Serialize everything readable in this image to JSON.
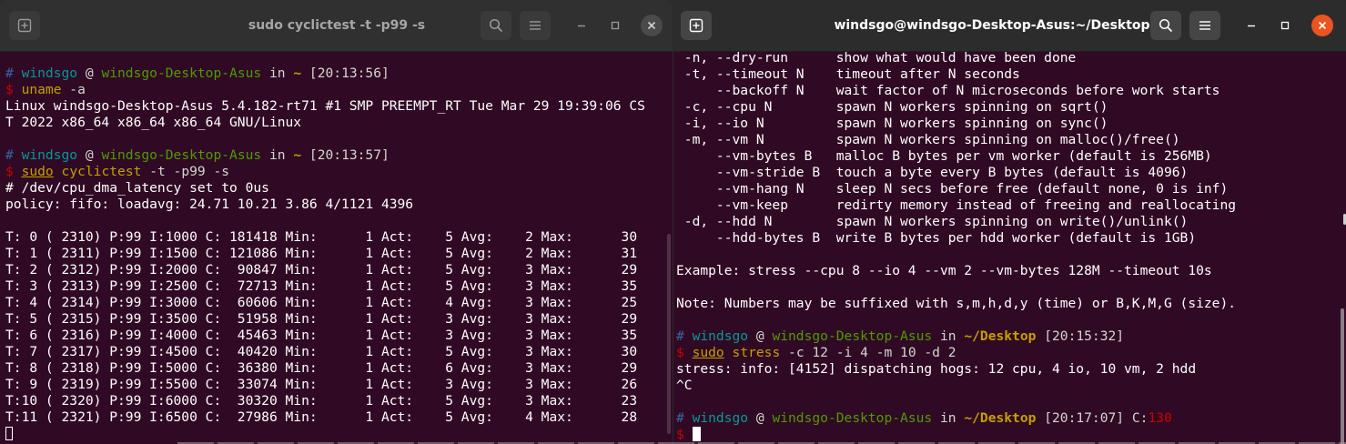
{
  "left_window": {
    "title": "sudo cyclictest -t -p99 -s",
    "lines": [
      [
        {
          "t": "# ",
          "c": "hash"
        },
        {
          "t": "windsgo",
          "c": "user"
        },
        {
          "t": " @ ",
          "c": "at"
        },
        {
          "t": "windsgo-Desktop-Asus",
          "c": "host"
        },
        {
          "t": " in ",
          "c": "in"
        },
        {
          "t": "~",
          "c": "path"
        },
        {
          "t": " [20:13:56]",
          "c": "time"
        }
      ],
      [
        {
          "t": "$ ",
          "c": "dollar"
        },
        {
          "t": "uname",
          "c": "cmd"
        },
        {
          "t": " -a",
          "c": "args"
        }
      ],
      [
        {
          "t": "Linux windsgo-Desktop-Asus 5.4.182-rt71 #1 SMP PREEMPT_RT Tue Mar 29 19:39:06 CS"
        }
      ],
      [
        {
          "t": "T 2022 x86_64 x86_64 x86_64 GNU/Linux"
        }
      ],
      [],
      [
        {
          "t": "# ",
          "c": "hash"
        },
        {
          "t": "windsgo",
          "c": "user"
        },
        {
          "t": " @ ",
          "c": "at"
        },
        {
          "t": "windsgo-Desktop-Asus",
          "c": "host"
        },
        {
          "t": " in ",
          "c": "in"
        },
        {
          "t": "~",
          "c": "path"
        },
        {
          "t": " [20:13:57]",
          "c": "time"
        }
      ],
      [
        {
          "t": "$ ",
          "c": "dollar"
        },
        {
          "t": "sudo",
          "c": "cmdu"
        },
        {
          "t": " ",
          "c": "args"
        },
        {
          "t": "cyclictest",
          "c": "cmd"
        },
        {
          "t": " -t -p99 -s",
          "c": "args"
        }
      ],
      [
        {
          "t": "# /dev/cpu_dma_latency set to 0us"
        }
      ],
      [
        {
          "t": "policy: fifo: loadavg: 24.71 10.21 3.86 4/1121 4396"
        }
      ],
      [],
      [
        {
          "t": "T: 0 ( 2310) P:99 I:1000 C: 181418 Min:      1 Act:    5 Avg:    2 Max:      30"
        }
      ],
      [
        {
          "t": "T: 1 ( 2311) P:99 I:1500 C: 121086 Min:      1 Act:    5 Avg:    2 Max:      31"
        }
      ],
      [
        {
          "t": "T: 2 ( 2312) P:99 I:2000 C:  90847 Min:      1 Act:    5 Avg:    3 Max:      29"
        }
      ],
      [
        {
          "t": "T: 3 ( 2313) P:99 I:2500 C:  72713 Min:      1 Act:    5 Avg:    3 Max:      35"
        }
      ],
      [
        {
          "t": "T: 4 ( 2314) P:99 I:3000 C:  60606 Min:      1 Act:    4 Avg:    3 Max:      25"
        }
      ],
      [
        {
          "t": "T: 5 ( 2315) P:99 I:3500 C:  51958 Min:      1 Act:    3 Avg:    3 Max:      29"
        }
      ],
      [
        {
          "t": "T: 6 ( 2316) P:99 I:4000 C:  45463 Min:      1 Act:    3 Avg:    3 Max:      35"
        }
      ],
      [
        {
          "t": "T: 7 ( 2317) P:99 I:4500 C:  40420 Min:      1 Act:    5 Avg:    3 Max:      30"
        }
      ],
      [
        {
          "t": "T: 8 ( 2318) P:99 I:5000 C:  36380 Min:      1 Act:    6 Avg:    3 Max:      29"
        }
      ],
      [
        {
          "t": "T: 9 ( 2319) P:99 I:5500 C:  33074 Min:      1 Act:    3 Avg:    3 Max:      26"
        }
      ],
      [
        {
          "t": "T:10 ( 2320) P:99 I:6000 C:  30320 Min:      1 Act:    5 Avg:    3 Max:      23"
        }
      ],
      [
        {
          "t": "T:11 ( 2321) P:99 I:6500 C:  27986 Min:      1 Act:    5 Avg:    4 Max:      28"
        }
      ],
      [
        {
          "cursor": "hollow"
        }
      ]
    ]
  },
  "right_window": {
    "title": "windsgo@windsgo-Desktop-Asus:~/Desktop",
    "lines": [
      [
        {
          "t": " -n, --dry-run      show what would have been done"
        }
      ],
      [
        {
          "t": " -t, --timeout N    timeout after N seconds"
        }
      ],
      [
        {
          "t": "     --backoff N    wait factor of N microseconds before work starts"
        }
      ],
      [
        {
          "t": " -c, --cpu N        spawn N workers spinning on sqrt()"
        }
      ],
      [
        {
          "t": " -i, --io N         spawn N workers spinning on sync()"
        }
      ],
      [
        {
          "t": " -m, --vm N         spawn N workers spinning on malloc()/free()"
        }
      ],
      [
        {
          "t": "     --vm-bytes B   malloc B bytes per vm worker (default is 256MB)"
        }
      ],
      [
        {
          "t": "     --vm-stride B  touch a byte every B bytes (default is 4096)"
        }
      ],
      [
        {
          "t": "     --vm-hang N    sleep N secs before free (default none, 0 is inf)"
        }
      ],
      [
        {
          "t": "     --vm-keep      redirty memory instead of freeing and reallocating"
        }
      ],
      [
        {
          "t": " -d, --hdd N        spawn N workers spinning on write()/unlink()"
        }
      ],
      [
        {
          "t": "     --hdd-bytes B  write B bytes per hdd worker (default is 1GB)"
        }
      ],
      [],
      [
        {
          "t": "Example: stress --cpu 8 --io 4 --vm 2 --vm-bytes 128M --timeout 10s"
        }
      ],
      [],
      [
        {
          "t": "Note: Numbers may be suffixed with s,m,h,d,y (time) or B,K,M,G (size)."
        }
      ],
      [],
      [
        {
          "t": "# ",
          "c": "hash"
        },
        {
          "t": "windsgo",
          "c": "user"
        },
        {
          "t": " @ ",
          "c": "at"
        },
        {
          "t": "windsgo-Desktop-Asus",
          "c": "host"
        },
        {
          "t": " in ",
          "c": "in"
        },
        {
          "t": "~/Desktop",
          "c": "path"
        },
        {
          "t": " [20:15:32]",
          "c": "time"
        }
      ],
      [
        {
          "t": "$ ",
          "c": "dollar"
        },
        {
          "t": "sudo",
          "c": "cmdu"
        },
        {
          "t": " ",
          "c": "args"
        },
        {
          "t": "stress",
          "c": "cmd"
        },
        {
          "t": " -c 12 -i 4 -m 10 -d 2",
          "c": "args"
        }
      ],
      [
        {
          "t": "stress: info: [4152] dispatching hogs: 12 cpu, 4 io, 10 vm, 2 hdd"
        }
      ],
      [
        {
          "t": "^C"
        }
      ],
      [],
      [
        {
          "t": "# ",
          "c": "hash"
        },
        {
          "t": "windsgo",
          "c": "user"
        },
        {
          "t": " @ ",
          "c": "at"
        },
        {
          "t": "windsgo-Desktop-Asus",
          "c": "host"
        },
        {
          "t": " in ",
          "c": "in"
        },
        {
          "t": "~/Desktop",
          "c": "path"
        },
        {
          "t": " [20:17:07] C:",
          "c": "time"
        },
        {
          "t": "130",
          "c": "cval"
        }
      ],
      [
        {
          "t": "$ ",
          "c": "dollar"
        },
        {
          "cursor": "block"
        }
      ]
    ]
  },
  "icons": {
    "new_tab": "new-tab-icon",
    "search": "search-icon",
    "menu": "hamburger-menu-icon",
    "minimize": "minimize-icon",
    "maximize": "maximize-icon",
    "close": "close-icon"
  },
  "colors": {
    "terminal_bg": "#300a24",
    "titlebar_inactive": "#303030",
    "titlebar_active": "#2c2c2c",
    "close_active": "#e95420",
    "close_inactive": "#4a4a4a"
  }
}
